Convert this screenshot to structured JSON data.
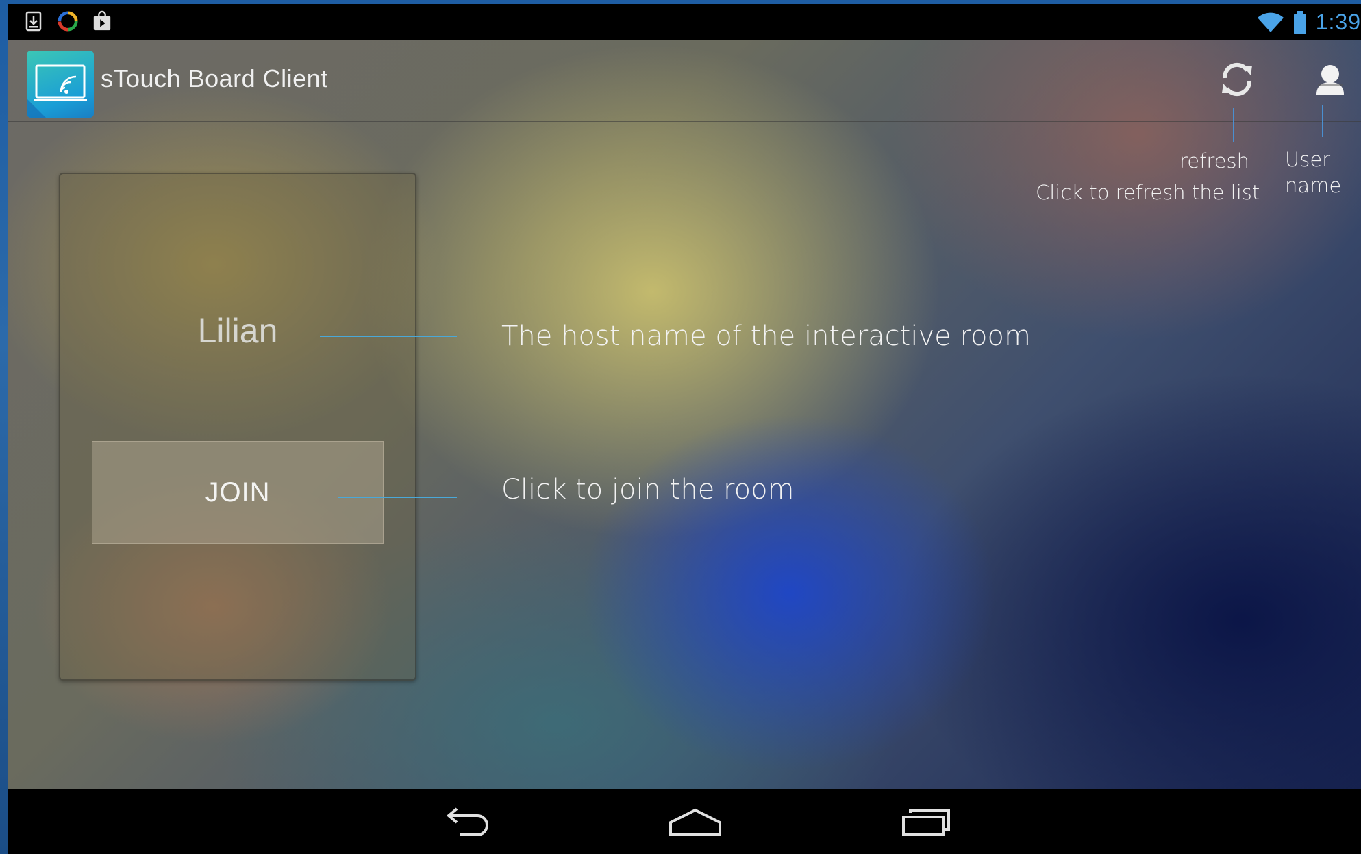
{
  "status_bar": {
    "time": "1:39"
  },
  "action_bar": {
    "title": "sTouch Board Client"
  },
  "annotations": {
    "refresh_title": "refresh",
    "refresh_desc": "Click to refresh the list",
    "user_line1": "User",
    "user_line2": "name",
    "host_desc": "The host name of the interactive room",
    "join_desc": "Click to join the room"
  },
  "room": {
    "host_name": "Lilian",
    "join_label": "JOIN"
  },
  "colors": {
    "clock": "#4aa3e8",
    "annotation_line": "#4aa8d8",
    "app_logo": "#1a9ed6"
  }
}
